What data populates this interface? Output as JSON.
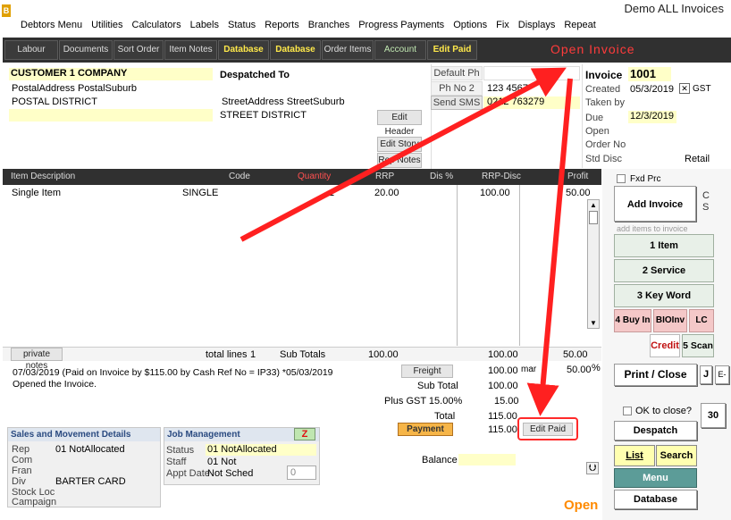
{
  "app": {
    "logo": "B",
    "window_title": "Demo ALL Invoices"
  },
  "menu": [
    "Debtors Menu",
    "Utilities",
    "Calculators",
    "Labels",
    "Status",
    "Reports",
    "Branches",
    "Progress Payments",
    "Options",
    "Fix",
    "Displays",
    "Repeat"
  ],
  "toolbar": {
    "labour": "Labour",
    "documents": "Documents",
    "sort_order": "Sort Order",
    "item_notes": "Item Notes",
    "database1": "Database",
    "database2": "Database",
    "order_items": "Order Items",
    "account": "Account",
    "edit_paid": "Edit Paid"
  },
  "open_invoice_title": "Open  Invoice",
  "customer": {
    "name": "CUSTOMER 1 COMPANY",
    "postal_line1": "PostalAddress PostalSuburb",
    "postal_line2": "POSTAL DISTRICT",
    "dispatched_to": "Despatched To",
    "street_line1": "StreetAddress StreetSuburb",
    "street_line2": "STREET DISTRICT"
  },
  "header_buttons": {
    "edit_header": "Edit Header",
    "edit_story": "Edit Story",
    "rep_notes": "Rep Notes"
  },
  "phones": {
    "default_ph_label": "Default Ph",
    "ph_no2_label": "Ph No 2",
    "ph_no2": "123 4567",
    "send_sms": "Send SMS",
    "sms_number": "0212 763279"
  },
  "invoice": {
    "invoice_label": "Invoice",
    "invoice_no": "1001",
    "created_label": "Created",
    "created": "05/3/2019",
    "gst_label": "GST",
    "taken_by_label": "Taken by",
    "due_label": "Due",
    "due": "12/3/2019",
    "open_label": "Open",
    "order_no_label": "Order No",
    "std_disc_label": "Std Disc",
    "std_disc": "Retail"
  },
  "items": {
    "columns": {
      "description": "Item Description",
      "code": "Code",
      "quantity": "Quantity",
      "rrp": "RRP",
      "disc": "Dis %",
      "rrp_disc": "RRP-Disc",
      "profit": "Profit"
    },
    "rows": [
      {
        "description": "Single Item",
        "code": "SINGLE",
        "quantity": "1",
        "rrp": "20.00",
        "rrp_disc": "100.00",
        "profit": "50.00"
      }
    ]
  },
  "footer": {
    "private_notes": "private notes",
    "total_lines_label": "total lines",
    "total_lines": "1",
    "sub_totals_label": "Sub Totals",
    "sub_totals_rrp": "100.00",
    "sub_totals_disc": "100.00",
    "sub_totals_profit": "50.00",
    "log_line1": "07/03/2019 (Paid on Invoice by  $115.00 by Cash Ref No = IP33) *05/03/2019",
    "log_line2": "Opened the Invoice.",
    "freight": "Freight",
    "freight_value": "100.00",
    "sub_total_label": "Sub Total",
    "sub_total": "100.00",
    "gst_label": "Plus GST 15.00%",
    "gst": "15.00",
    "total_label": "Total",
    "total": "115.00",
    "payment": "Payment",
    "payment_value": "115.00",
    "edit_paid": "Edit Paid",
    "balance_label": "Balance",
    "margin_label": "mar",
    "margin": "50.00",
    "margin_unit": "%",
    "status_word": "Open"
  },
  "sales_panel": {
    "title": "Sales and Movement Details",
    "rep_label": "Rep",
    "rep": "01 NotAllocated",
    "com_label": "Com",
    "fran_label": "Fran",
    "div_label": "Div",
    "div": "BARTER CARD",
    "stock_loc_label": "Stock Loc",
    "campaign_label": "Campaign"
  },
  "job_panel": {
    "title": "Job Management",
    "z_button": "Z",
    "status_label": "Status",
    "status": "01 NotAllocated",
    "staff_label": "Staff",
    "staff": "01 Not",
    "appt_label": "Appt Date",
    "appt": "Not Sched",
    "appt_count": "0"
  },
  "right_panel": {
    "fxd_prc": "Fxd Prc",
    "add_invoice": "Add Invoice",
    "cs": "C\nS",
    "add_items_hint": "add items to invoice",
    "item": "1 Item",
    "service": "2 Service",
    "key_word": "3 Key Word",
    "buy_in": "4 Buy In",
    "bio_inv": "BIOInv",
    "lc": "LC",
    "credit": "Credit",
    "scan": "5 Scan",
    "print_close": "Print / Close",
    "j": "J",
    "e": "E-",
    "ok_to_close": "OK to close?",
    "thirty": "30",
    "despatch": "Despatch",
    "list": "List",
    "search": "Search",
    "menu": "Menu",
    "database": "Database"
  },
  "colors": {
    "toolbar_bg": "#303030",
    "accent_red": "#ff2020",
    "yellow_field": "#ffffc8",
    "teal_menu": "#5c9c98",
    "orange_status": "#ff8a00"
  }
}
